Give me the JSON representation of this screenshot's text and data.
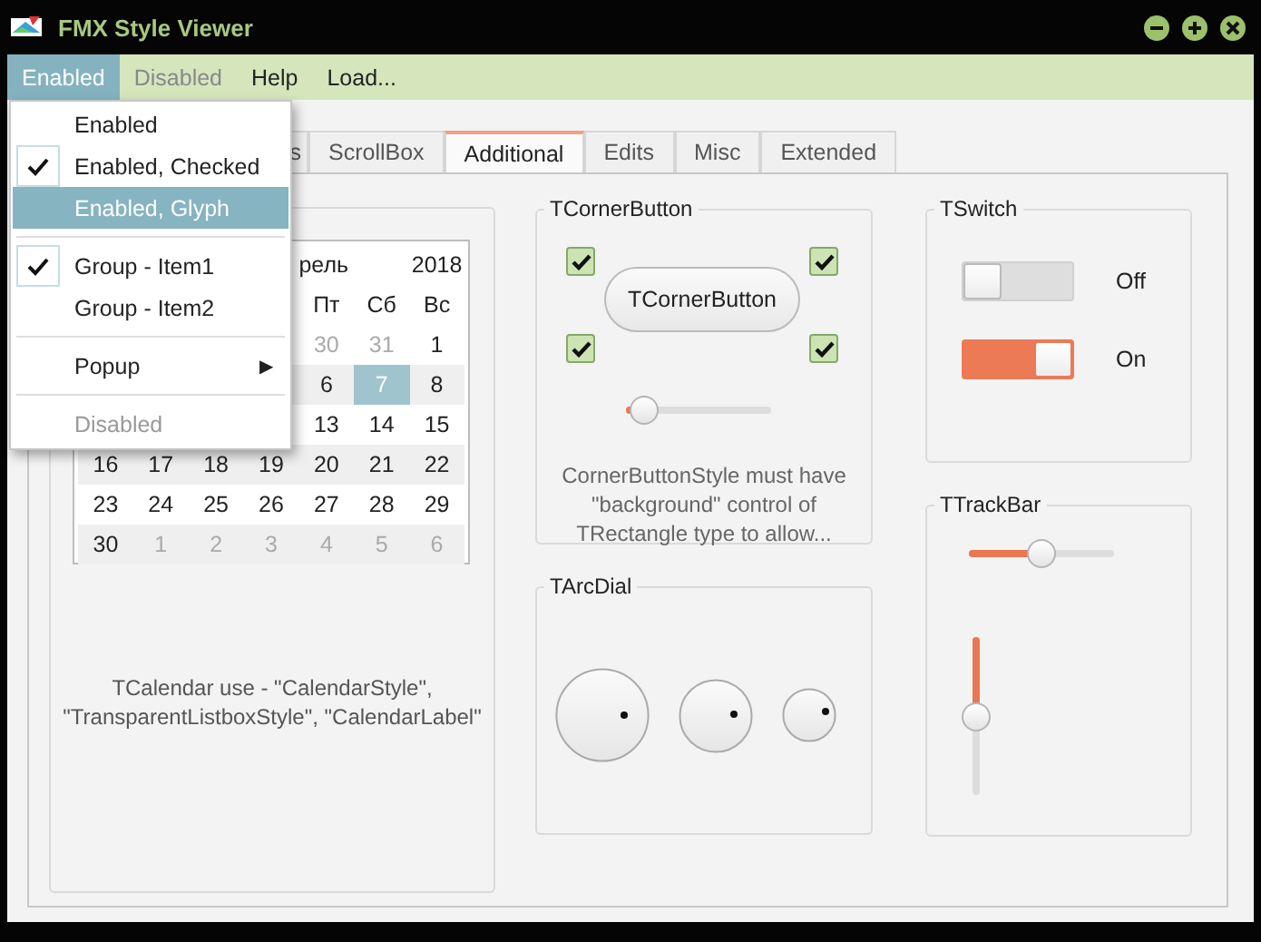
{
  "window": {
    "title": "FMX Style Viewer"
  },
  "menubar": [
    {
      "label": "Enabled",
      "selected": true,
      "disabled": false
    },
    {
      "label": "Disabled",
      "selected": false,
      "disabled": true
    },
    {
      "label": "Help",
      "selected": false,
      "disabled": false
    },
    {
      "label": "Load...",
      "selected": false,
      "disabled": false
    }
  ],
  "menu": {
    "items": [
      {
        "kind": "item",
        "label": "Enabled",
        "checked": false,
        "selected": false,
        "disabled": false
      },
      {
        "kind": "item",
        "label": "Enabled, Checked",
        "checked": true,
        "selected": false,
        "disabled": false
      },
      {
        "kind": "item",
        "label": "Enabled, Glyph",
        "checked": false,
        "selected": true,
        "disabled": false
      },
      {
        "kind": "separator"
      },
      {
        "kind": "item",
        "label": "Group - Item1",
        "checked": true,
        "selected": false,
        "disabled": false
      },
      {
        "kind": "item",
        "label": "Group - Item2",
        "checked": false,
        "selected": false,
        "disabled": false
      },
      {
        "kind": "separator"
      },
      {
        "kind": "submenu",
        "label": "Popup",
        "arrow": "▶",
        "checked": false,
        "selected": false,
        "disabled": false
      },
      {
        "kind": "separator"
      },
      {
        "kind": "item",
        "label": "Disabled",
        "checked": false,
        "selected": false,
        "disabled": true
      }
    ]
  },
  "tabs": [
    {
      "label": "s",
      "selected": false
    },
    {
      "label": "ScrollBox",
      "selected": false
    },
    {
      "label": "Additional",
      "selected": true
    },
    {
      "label": "Edits",
      "selected": false
    },
    {
      "label": "Misc",
      "selected": false
    },
    {
      "label": "Extended",
      "selected": false
    }
  ],
  "calendar": {
    "month": "рель",
    "year": "2018",
    "weekdays": [
      "Пт",
      "Сб",
      "Вс"
    ],
    "weeks": [
      [
        {
          "day": "30",
          "dim": true,
          "selected": false
        },
        {
          "day": "31",
          "dim": true,
          "selected": false
        },
        {
          "day": "1",
          "dim": false,
          "selected": false
        }
      ],
      [
        {
          "day": "6",
          "dim": false,
          "selected": false
        },
        {
          "day": "7",
          "dim": false,
          "selected": true
        },
        {
          "day": "8",
          "dim": false,
          "selected": false
        }
      ],
      [
        {
          "day": "13",
          "dim": false,
          "selected": false
        },
        {
          "day": "14",
          "dim": false,
          "selected": false
        },
        {
          "day": "15",
          "dim": false,
          "selected": false
        }
      ],
      [
        {
          "day": "16",
          "dim": false,
          "selected": false
        },
        {
          "day": "17",
          "dim": false,
          "selected": false
        },
        {
          "day": "18",
          "dim": false,
          "selected": false
        },
        {
          "day": "19",
          "dim": false,
          "selected": false
        },
        {
          "day": "20",
          "dim": false,
          "selected": false
        },
        {
          "day": "21",
          "dim": false,
          "selected": false
        },
        {
          "day": "22",
          "dim": false,
          "selected": false
        }
      ],
      [
        {
          "day": "23",
          "dim": false,
          "selected": false
        },
        {
          "day": "24",
          "dim": false,
          "selected": false
        },
        {
          "day": "25",
          "dim": false,
          "selected": false
        },
        {
          "day": "26",
          "dim": false,
          "selected": false
        },
        {
          "day": "27",
          "dim": false,
          "selected": false
        },
        {
          "day": "28",
          "dim": false,
          "selected": false
        },
        {
          "day": "29",
          "dim": false,
          "selected": false
        }
      ],
      [
        {
          "day": "30",
          "dim": false,
          "selected": false
        },
        {
          "day": "1",
          "dim": true,
          "selected": false
        },
        {
          "day": "2",
          "dim": true,
          "selected": false
        },
        {
          "day": "3",
          "dim": true,
          "selected": false
        },
        {
          "day": "4",
          "dim": true,
          "selected": false
        },
        {
          "day": "5",
          "dim": true,
          "selected": false
        },
        {
          "day": "6",
          "dim": true,
          "selected": false
        }
      ]
    ],
    "note": "TCalendar use - \"CalendarStyle\", \"TransparentListboxStyle\", \"CalendarLabel\""
  },
  "corner_button": {
    "title": "TCornerButton",
    "button": "TCornerButton",
    "checkboxes": [
      {
        "checked": true
      },
      {
        "checked": true
      },
      {
        "checked": true
      },
      {
        "checked": true
      }
    ],
    "slider": {
      "level": 0.12
    },
    "note": "CornerButtonStyle must have \"background\" control of TRectangle type to allow..."
  },
  "arc_dial": {
    "title": "TArcDial"
  },
  "switch": {
    "title": "TSwitch",
    "switches": [
      {
        "label": "Off",
        "on": false
      },
      {
        "label": "On",
        "on": true
      }
    ]
  },
  "trackbar": {
    "title": "TTrackBar",
    "horizontal": {
      "level": 0.5
    },
    "vertical": {
      "level": 0.5
    }
  }
}
